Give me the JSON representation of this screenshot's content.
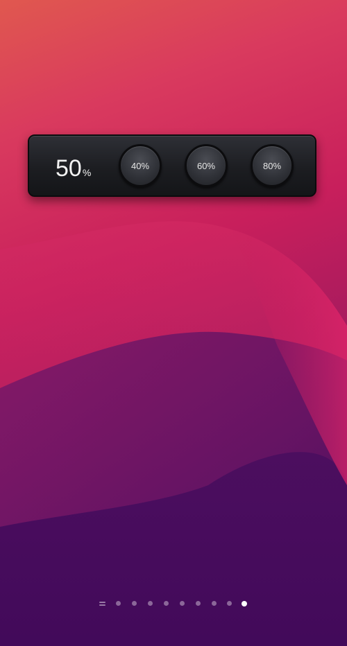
{
  "home_screen": {
    "widget": {
      "battery_value": "50",
      "battery_unit": "%",
      "buttons": [
        {
          "label": "40%"
        },
        {
          "label": "60%"
        },
        {
          "label": "80%"
        }
      ]
    },
    "page_indicator": {
      "first_icon": "list-icon",
      "page_count": 10,
      "active_page": 10
    },
    "colors": {
      "widget_background": "#1c1d21",
      "text": "#f2f2f2",
      "active_dot": "#ffffff"
    }
  }
}
